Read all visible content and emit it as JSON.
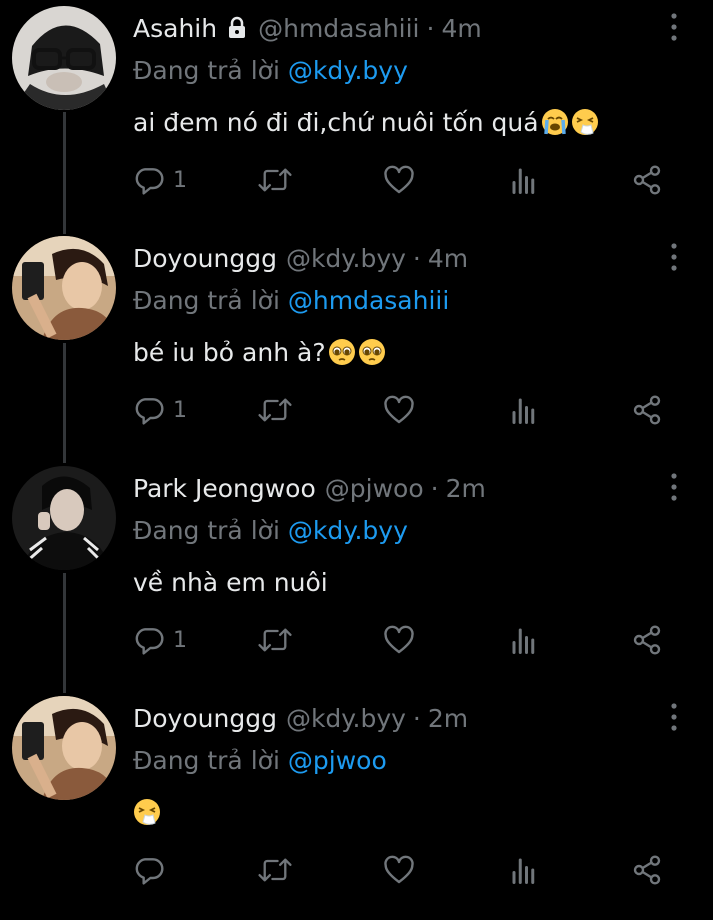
{
  "reply_prefix": "Đang trả lời",
  "tweets": [
    {
      "name": "Asahih",
      "locked": true,
      "handle": "@hmdasahiii",
      "dot": "·",
      "time": "4m",
      "reply_to": "@kdy.byy",
      "text": "ai đem nó đi đi,chứ nuôi tốn quá",
      "emojis": [
        "loudly-crying-face",
        "sneezing-face"
      ],
      "reply_count": "1",
      "avatar": "avatar-asahih"
    },
    {
      "name": "Doyounggg",
      "locked": false,
      "handle": "@kdy.byy",
      "dot": "·",
      "time": "4m",
      "reply_to": "@hmdasahiii",
      "text": "bé iu bỏ anh à?",
      "emojis": [
        "pleading-face",
        "pleading-face"
      ],
      "reply_count": "1",
      "avatar": "avatar-doyounggg"
    },
    {
      "name": "Park Jeongwoo",
      "locked": false,
      "handle": "@pjwoo",
      "dot": "·",
      "time": "2m",
      "reply_to": "@kdy.byy",
      "text": "về nhà em nuôi",
      "emojis": [],
      "reply_count": "1",
      "avatar": "avatar-park-jeongwoo"
    },
    {
      "name": "Doyounggg",
      "locked": false,
      "handle": "@kdy.byy",
      "dot": "·",
      "time": "2m",
      "reply_to": "@pjwoo",
      "text": "",
      "emojis": [
        "sneezing-face"
      ],
      "reply_count": "",
      "avatar": "avatar-doyounggg"
    }
  ],
  "colors": {
    "background": "#000000",
    "primary_text": "#e7e9ea",
    "secondary_text": "#71767b",
    "mention": "#1d9bf0",
    "thread_line": "#333639"
  }
}
